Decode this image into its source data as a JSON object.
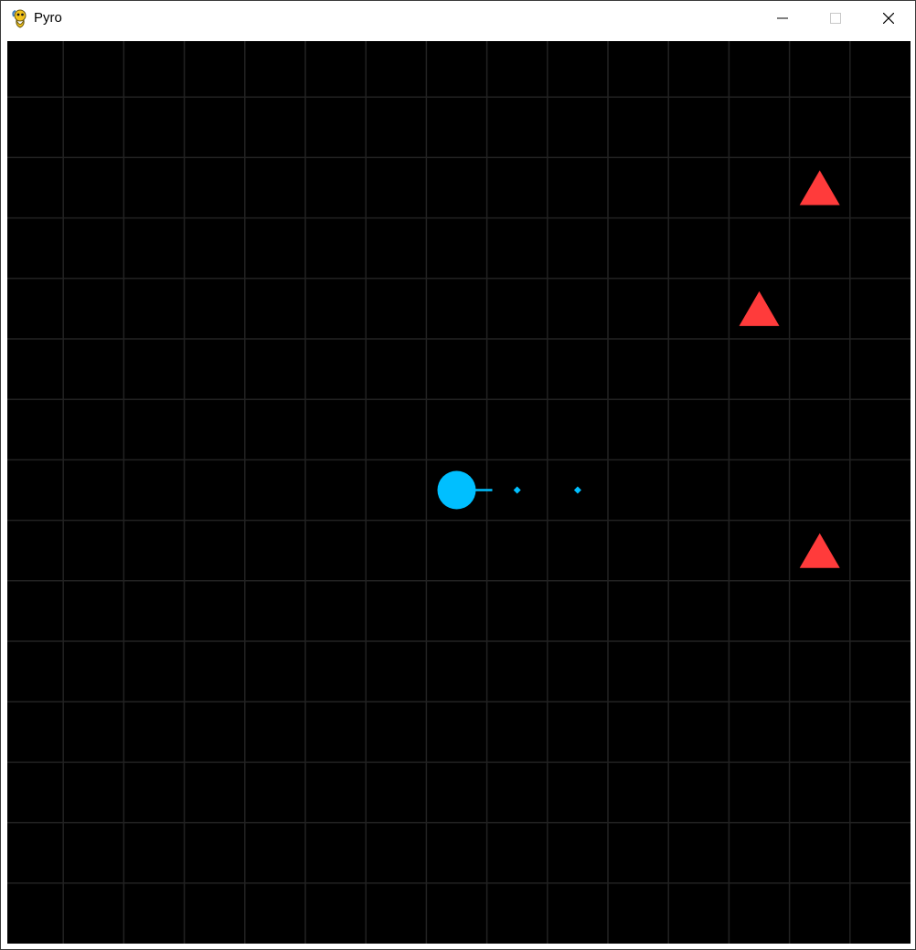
{
  "window": {
    "title": "Pyro",
    "controls": {
      "minimize_icon": "minimize-icon",
      "maximize_icon": "maximize-icon",
      "close_icon": "close-icon"
    }
  },
  "game": {
    "background_color": "#000000",
    "grid_color": "#222222",
    "grid_columns": 15,
    "grid_rows": 15,
    "player": {
      "color": "#00bfff",
      "heading": "right",
      "column": 7,
      "row": 7
    },
    "projectiles": [
      {
        "color": "#00bfff",
        "column": 8.5,
        "row": 7.5
      },
      {
        "color": "#00bfff",
        "column": 9.5,
        "row": 7.5
      }
    ],
    "enemies": [
      {
        "color": "#ff3b3b",
        "shape": "triangle",
        "column": 13,
        "row": 2
      },
      {
        "color": "#ff3b3b",
        "shape": "triangle",
        "column": 12,
        "row": 4
      },
      {
        "color": "#ff3b3b",
        "shape": "triangle",
        "column": 13,
        "row": 8
      }
    ]
  }
}
